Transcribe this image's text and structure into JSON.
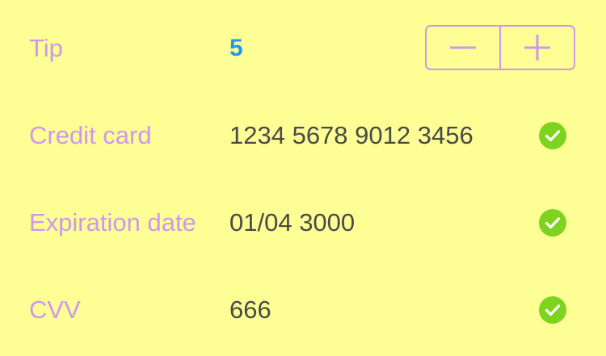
{
  "form": {
    "tip": {
      "label": "Tip",
      "value": "5",
      "decrement_icon": "minus-icon",
      "increment_icon": "plus-icon"
    },
    "credit_card": {
      "label": "Credit card",
      "value": "1234 5678 9012 3456",
      "status_icon": "check-circle-icon"
    },
    "expiration_date": {
      "label": "Expiration date",
      "value": "01/04 3000",
      "status_icon": "check-circle-icon"
    },
    "cvv": {
      "label": "CVV",
      "value": "666",
      "status_icon": "check-circle-icon"
    }
  },
  "colors": {
    "background": "#fdfe93",
    "label": "#cf97f0",
    "value": "#4a4a48",
    "tip_value": "#1f98f0",
    "valid_check": "#7ed321"
  }
}
